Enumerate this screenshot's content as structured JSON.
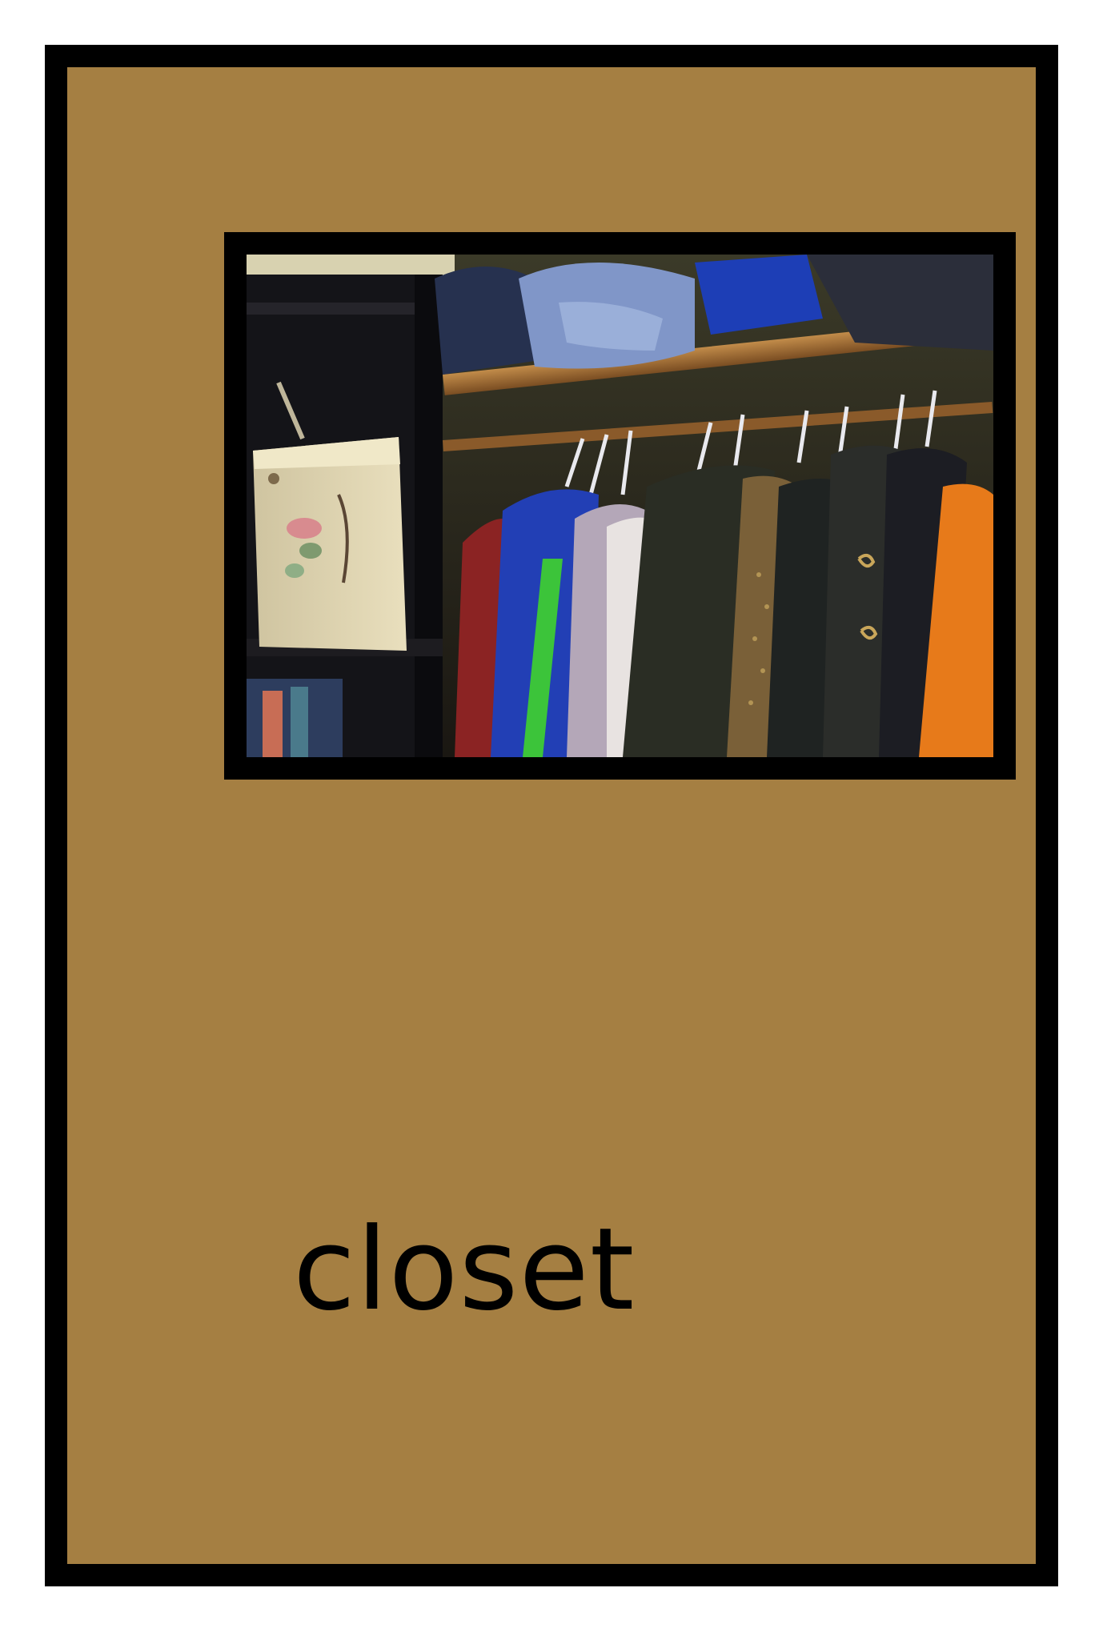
{
  "card": {
    "word": "closet",
    "background_color": "#a57f42",
    "border_color": "#000000",
    "picture": "closet-photo"
  }
}
